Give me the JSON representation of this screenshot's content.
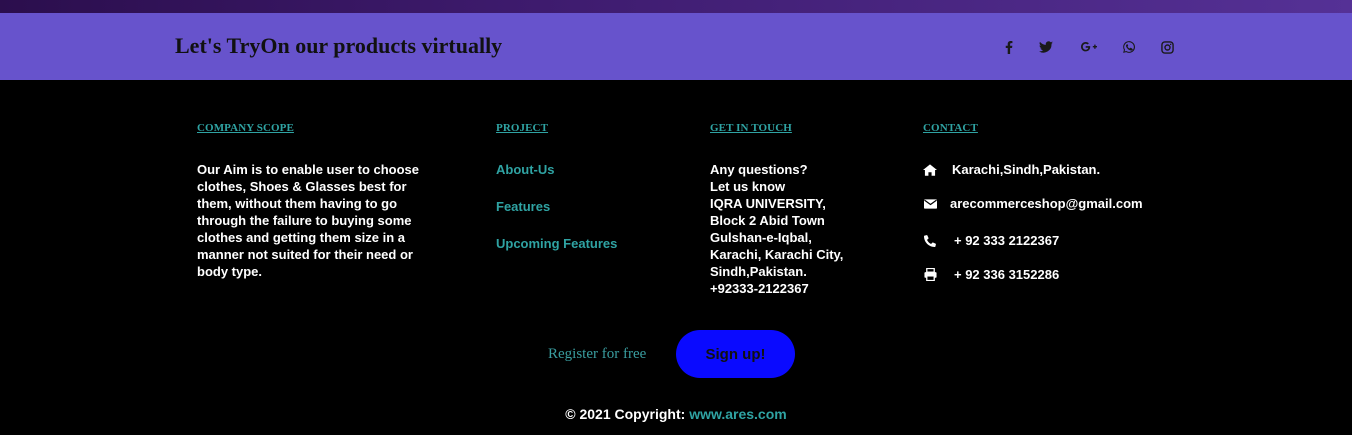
{
  "banner": {
    "title": "Let's TryOn our products virtually",
    "social_icons": [
      "facebook-icon",
      "twitter-icon",
      "google-plus-icon",
      "whatsapp-icon",
      "instagram-icon"
    ]
  },
  "company": {
    "heading": "COMPANY SCOPE",
    "text": "Our Aim is to enable user to choose clothes, Shoes & Glasses best for them, without them having to go through the failure to buying some clothes and getting them size in a manner not suited for their need or body type."
  },
  "project": {
    "heading": "PROJECT",
    "links": [
      "About-Us",
      "Features",
      "Upcoming Features"
    ]
  },
  "touch": {
    "heading": "GET IN TOUCH",
    "lines": [
      "Any questions?",
      "Let us know",
      "IQRA UNIVERSITY,",
      "Block 2 Abid Town",
      "Gulshan-e-Iqbal,",
      "Karachi, Karachi City,",
      "Sindh,Pakistan.",
      "+92333-2122367"
    ]
  },
  "contact": {
    "heading": "CONTACT",
    "address": "Karachi,Sindh,Pakistan.",
    "email": "arecommerceshop@gmail.com",
    "phone": "+ 92 333 2122367",
    "fax": "+ 92 336 3152286"
  },
  "register": {
    "label": "Register for free",
    "button": "Sign up!"
  },
  "copyright": {
    "prefix": "© 2021 Copyright:",
    "link": "www.ares.com"
  },
  "colors": {
    "banner": "#6753cc",
    "accent": "#2fa3a3",
    "signup_button": "#0a0aff",
    "background": "#000000"
  }
}
